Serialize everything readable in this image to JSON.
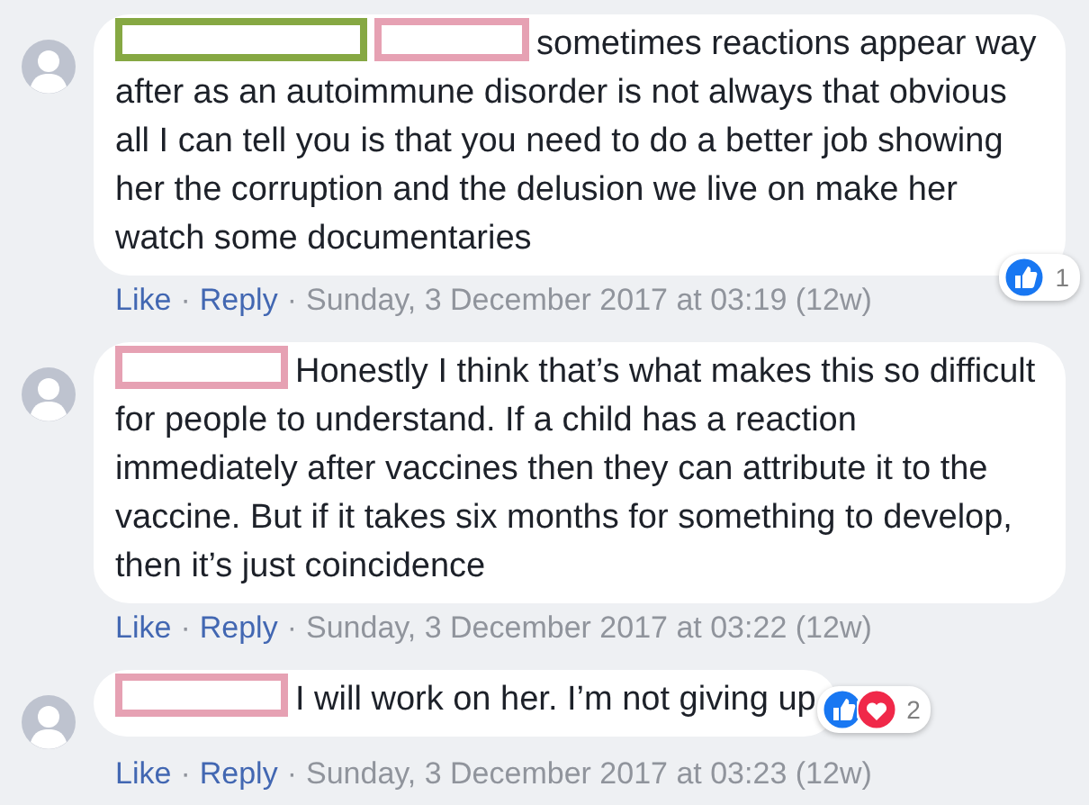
{
  "comments": [
    {
      "redactions": [
        {
          "color": "#86a843"
        },
        {
          "color": "#e6a1b3"
        }
      ],
      "text": "sometimes reactions appear way after as an autoimmune disorder is not always that obvious all I can tell you is that you need to do a better job showing her the corruption and the delusion we live on make her watch some documentaries",
      "reactions": {
        "icons": [
          {
            "kind": "like"
          }
        ],
        "count": "1"
      },
      "actions": [
        "Like",
        "Reply"
      ],
      "separators": [
        "·",
        "·"
      ],
      "time": "Sunday, 3 December 2017 at 03:19 (12w)"
    },
    {
      "redactions": [
        {
          "color": "#e6a1b3"
        }
      ],
      "text": "Honestly I think that’s what makes this so difficult for people to understand. If a child has a reaction immediately after vaccines then they can attribute it to the vaccine. But if it takes six months for something to develop, then it’s just coincidence",
      "actions": [
        "Like",
        "Reply"
      ],
      "separators": [
        "·",
        "·"
      ],
      "time": "Sunday, 3 December 2017 at 03:22 (12w)"
    },
    {
      "redactions": [
        {
          "color": "#e6a1b3"
        }
      ],
      "text": "I will work on her. I’m not giving up",
      "reactions": {
        "icons": [
          {
            "kind": "like"
          },
          {
            "kind": "love"
          }
        ],
        "count": "2"
      },
      "actions": [
        "Like",
        "Reply"
      ],
      "separators": [
        "·",
        "·"
      ],
      "time": "Sunday, 3 December 2017 at 03:23 (12w)"
    }
  ]
}
